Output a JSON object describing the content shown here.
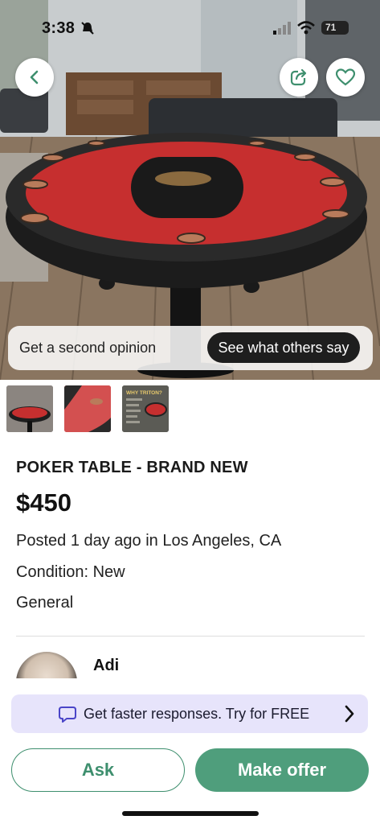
{
  "status_bar": {
    "time": "3:38",
    "battery": "71"
  },
  "hero": {
    "second_opinion_label": "Get a second opinion",
    "see_others_button": "See what others say"
  },
  "icons": {
    "back": "chevron-left-icon",
    "share": "share-icon",
    "favorite": "heart-icon",
    "promo": "chat-bubble-icon",
    "promo_arrow": "chevron-right-icon"
  },
  "thumbnails": [
    {
      "name": "thumbnail-poker-table-room"
    },
    {
      "name": "thumbnail-table-closeup"
    },
    {
      "name": "thumbnail-why-triton",
      "caption": "WHY TRITON?"
    }
  ],
  "listing": {
    "title": "POKER TABLE - BRAND NEW",
    "price": "$450",
    "posted": "Posted 1 day ago in Los Angeles, CA",
    "condition": "Condition: New",
    "category": "General"
  },
  "seller": {
    "name": "Adi"
  },
  "promo": {
    "text": "Get faster responses. Try for FREE"
  },
  "actions": {
    "ask": "Ask",
    "make_offer": "Make offer"
  },
  "colors": {
    "accent_green": "#4f9e7c",
    "promo_bg": "#e7e4fb",
    "table_felt": "#c62f2f"
  }
}
